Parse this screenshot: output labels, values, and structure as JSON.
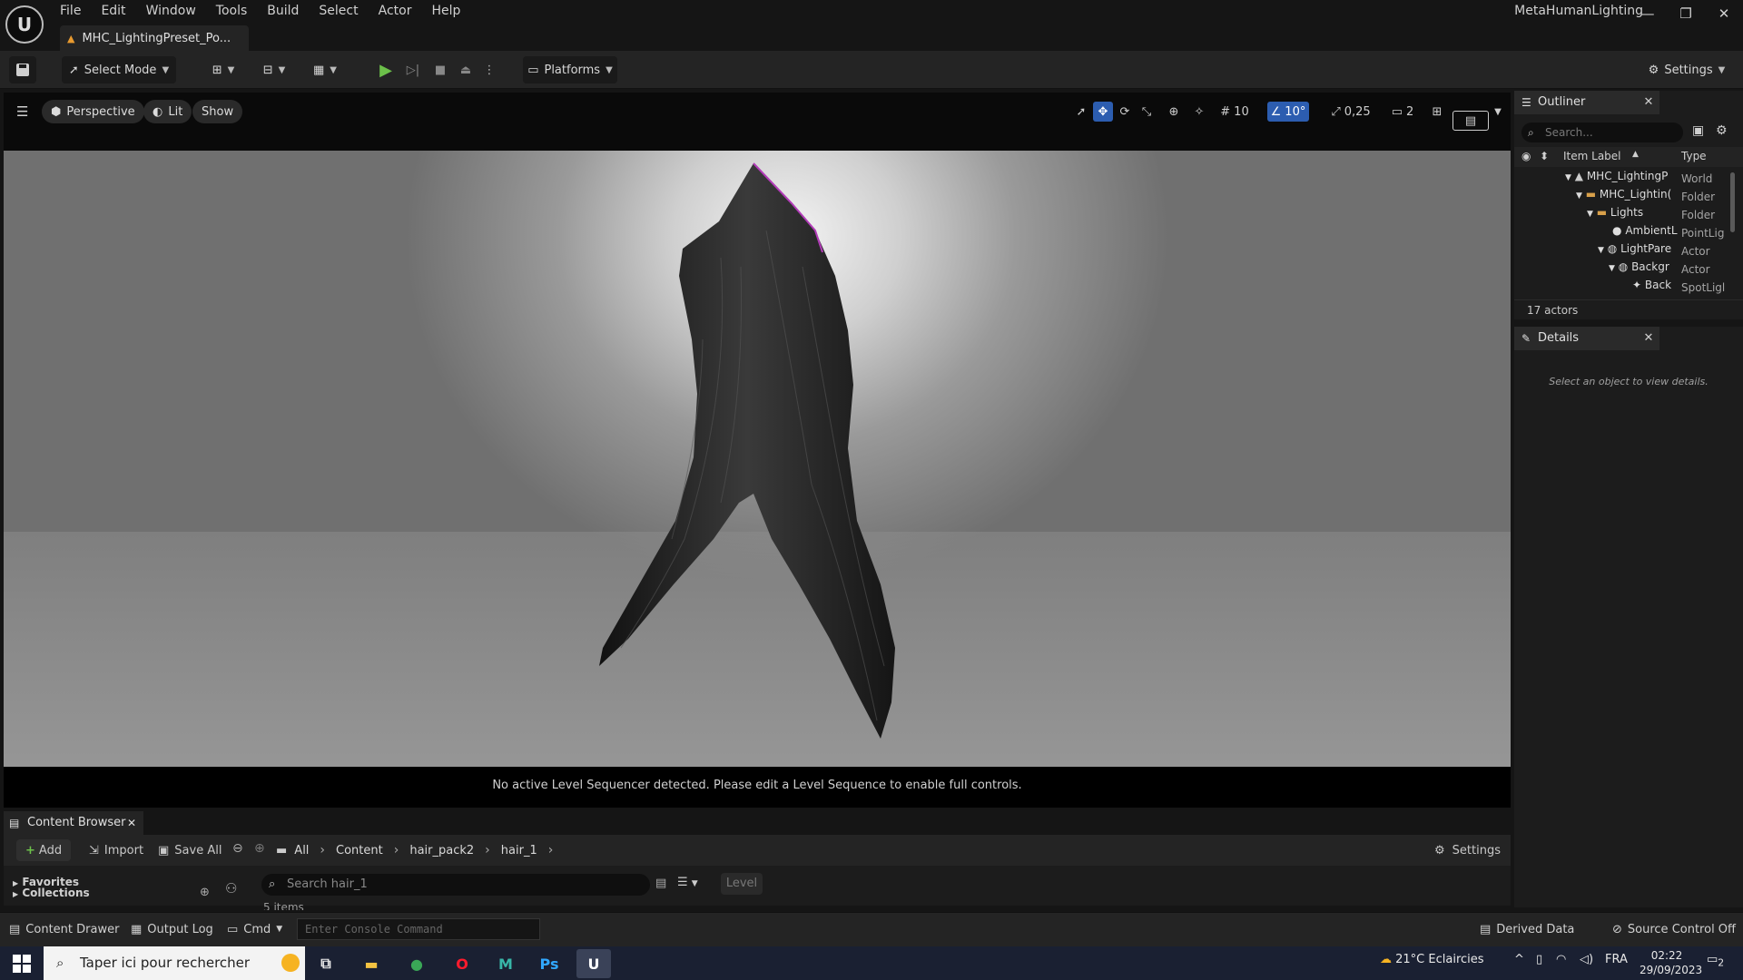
{
  "menu": [
    "File",
    "Edit",
    "Window",
    "Tools",
    "Build",
    "Select",
    "Actor",
    "Help"
  ],
  "app_logo": "U",
  "document_tab": "MHC_LightingPreset_Po...",
  "project_name": "MetaHumanLighting",
  "window_controls": {
    "minimize": "—",
    "restore": "❐",
    "close": "✕"
  },
  "toolbar": {
    "select_mode": "Select Mode",
    "platforms": "Platforms",
    "settings": "Settings"
  },
  "viewport": {
    "perspective": "Perspective",
    "lit": "Lit",
    "show": "Show",
    "grid_size": "10",
    "rotation_snap": "10°",
    "scale_snap": "0,25",
    "camera_speed": "2",
    "sequencer_message": "No active Level Sequencer detected. Please edit a Level Sequence to enable full controls."
  },
  "outliner": {
    "title": "Outliner",
    "search_placeholder": "Search...",
    "col_label": "Item Label",
    "col_type": "Type",
    "rows": [
      {
        "label": "MHC_LightingP",
        "type": "World"
      },
      {
        "label": "MHC_Lightin(",
        "type": "Folder"
      },
      {
        "label": "Lights",
        "type": "Folder"
      },
      {
        "label": "AmbientL",
        "type": "PointLig"
      },
      {
        "label": "LightPare",
        "type": "Actor"
      },
      {
        "label": "Backgr",
        "type": "Actor"
      },
      {
        "label": "Back",
        "type": "SpotLigl"
      }
    ],
    "actor_count": "17 actors"
  },
  "details": {
    "title": "Details",
    "empty_message": "Select an object to view details."
  },
  "content_browser": {
    "tab": "Content Browser",
    "add": "Add",
    "import": "Import",
    "save_all": "Save All",
    "breadcrumbs": [
      "All",
      "Content",
      "hair_pack2",
      "hair_1"
    ],
    "settings": "Settings",
    "search_placeholder": "Search hair_1",
    "level_chip": "Level",
    "favorites": "Favorites",
    "collections": "Collections",
    "items_count": "5 items"
  },
  "status_bar": {
    "content_drawer": "Content Drawer",
    "output_log": "Output Log",
    "cmd": "Cmd",
    "console_placeholder": "Enter Console Command",
    "derived_data": "Derived Data",
    "source_control": "Source Control Off"
  },
  "taskbar": {
    "search_placeholder": "Taper ici pour rechercher",
    "weather": "21°C  Eclaircies",
    "language": "FRA",
    "time": "02:22",
    "date": "29/09/2023",
    "notifications": "2",
    "apps": [
      {
        "name": "task-view",
        "label": "⧉",
        "color": "#e8e8e8"
      },
      {
        "name": "file-explorer",
        "label": "▬",
        "color": "#f4c342"
      },
      {
        "name": "chrome",
        "label": "●",
        "color": "#3aa757"
      },
      {
        "name": "opera",
        "label": "O",
        "color": "#ff1b2d"
      },
      {
        "name": "maya",
        "label": "M",
        "color": "#38b6a8"
      },
      {
        "name": "photoshop",
        "label": "Ps",
        "color": "#31a8ff"
      },
      {
        "name": "unreal",
        "label": "U",
        "color": "#ffffff"
      }
    ]
  },
  "accent_colors": {
    "play": "#6cc04a",
    "selection": "#2c5db0",
    "warning": "#e89a2f"
  }
}
